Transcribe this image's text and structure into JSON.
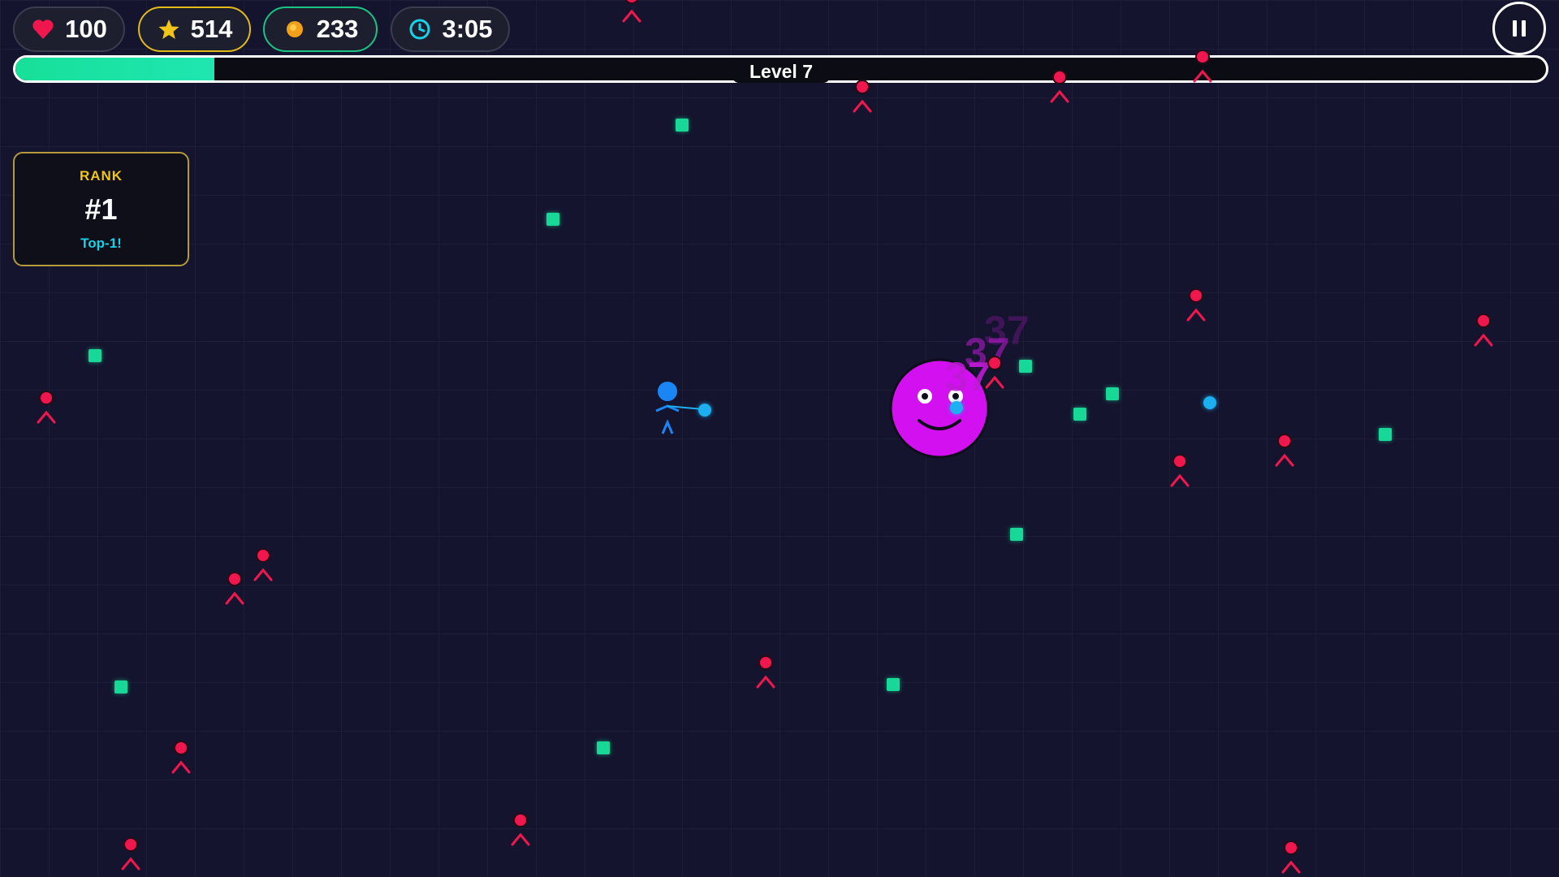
{
  "hud": {
    "health": "100",
    "score": "514",
    "coins": "233",
    "timer": "3:05",
    "icons": {
      "health": "heart-icon",
      "score": "star-icon",
      "coins": "coin-icon",
      "timer": "clock-icon",
      "pause": "pause-icon"
    }
  },
  "progress": {
    "level_label": "Level 7",
    "fill_fraction": 0.13
  },
  "rank": {
    "title": "RANK",
    "value": "#1",
    "subtitle": "Top-1!"
  },
  "damage_numbers": [
    "37",
    "37",
    "37"
  ],
  "colors": {
    "background": "#14142e",
    "enemy": "#f0164e",
    "gem": "#17d896",
    "orb": "#1cb0f0",
    "player": "#1a86f5",
    "boss": "#d210f0",
    "progress": "#17e09a",
    "score_accent": "#e3b91a",
    "coin_accent": "#19c483",
    "rank_accent": "#f0c419",
    "rank_sub": "#1ad0e8"
  }
}
